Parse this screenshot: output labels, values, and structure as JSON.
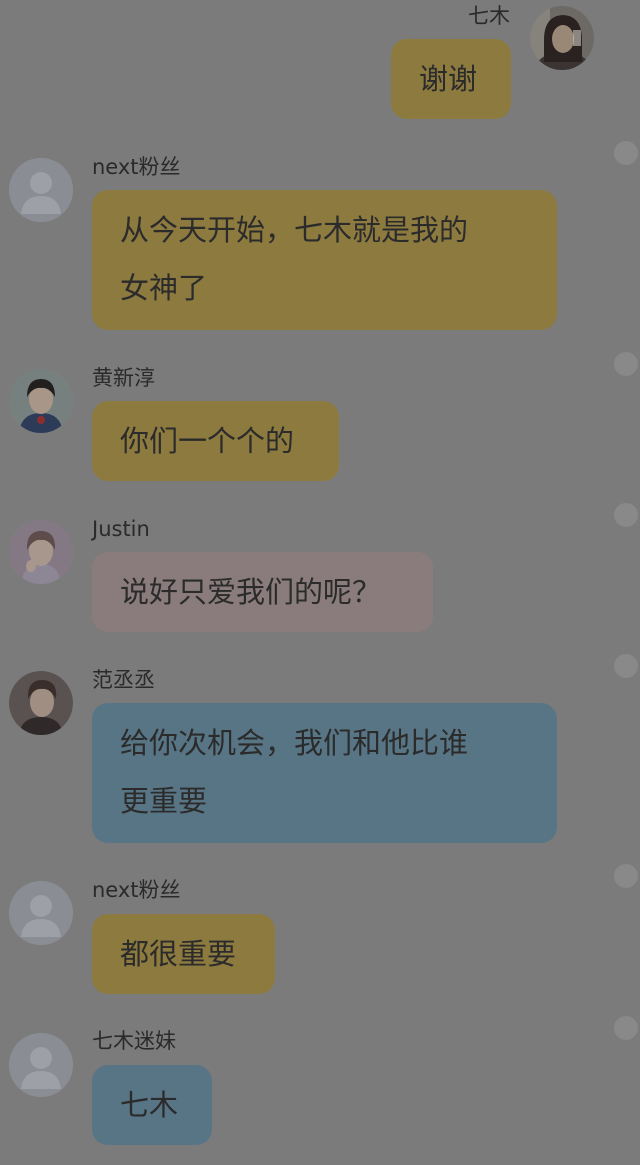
{
  "colors": {
    "background": "#7b7b7b",
    "bubble_gold": "#8d7a3f",
    "bubble_pink": "#8a7c7c",
    "bubble_blue": "#587585",
    "name_text": "#2a2a2a",
    "bubble_text": "#2b2b2b",
    "placeholder_avatar": "#8a8d93"
  },
  "messages": [
    {
      "sender": "七木",
      "side": "right",
      "avatar_icon": "woman-avatar-photo",
      "lines": [
        "谢谢"
      ],
      "color": "#8d7a3f"
    },
    {
      "sender": "next粉丝",
      "side": "left",
      "avatar_icon": "default-user-icon",
      "lines": [
        "从今天开始，七木就是我的",
        "女神了"
      ],
      "color": "#8d7a3f"
    },
    {
      "sender": "黄新淳",
      "side": "left",
      "avatar_icon": "man-avatar-photo",
      "lines": [
        "你们一个个的"
      ],
      "color": "#8d7a3f"
    },
    {
      "sender": "Justin",
      "side": "left",
      "avatar_icon": "man-avatar-photo",
      "lines": [
        "说好只爱我们的呢？"
      ],
      "color": "#8a7c7c"
    },
    {
      "sender": "范丞丞",
      "side": "left",
      "avatar_icon": "man-avatar-photo",
      "lines": [
        "给你次机会，我们和他比谁",
        "更重要"
      ],
      "color": "#587585"
    },
    {
      "sender": "next粉丝",
      "side": "left",
      "avatar_icon": "default-user-icon",
      "lines": [
        "都很重要"
      ],
      "color": "#8d7a3f"
    },
    {
      "sender": "七木迷妹",
      "side": "left",
      "avatar_icon": "default-user-icon",
      "lines": [
        "七木"
      ],
      "color": "#587585"
    }
  ]
}
